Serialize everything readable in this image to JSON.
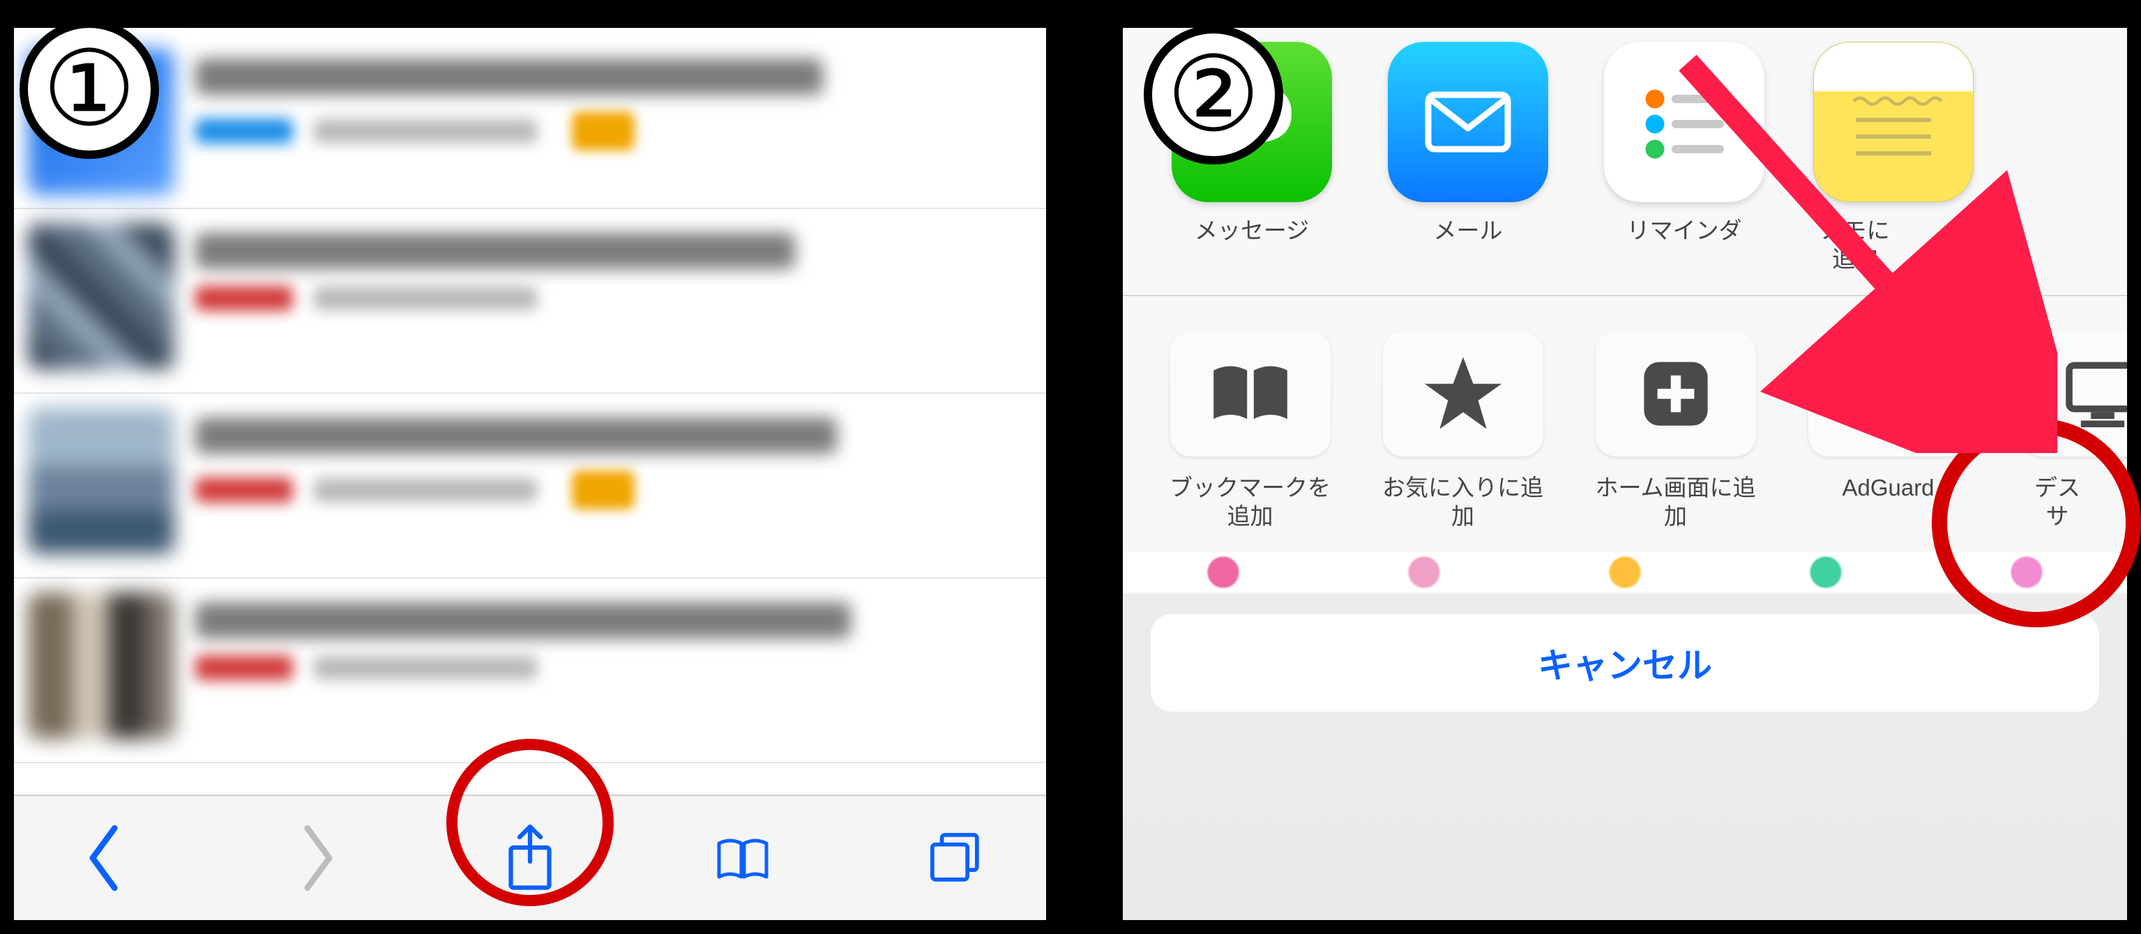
{
  "badges": {
    "one": "①",
    "two": "②"
  },
  "panel1": {
    "toolbar": {
      "back": "back-icon",
      "forward": "forward-icon",
      "share": "share-icon",
      "bookmarks": "bookmarks-icon",
      "tabs": "tabs-icon"
    }
  },
  "panel2": {
    "apps": [
      {
        "name": "messages",
        "label": "メッセージ"
      },
      {
        "name": "mail",
        "label": "メール"
      },
      {
        "name": "reminders",
        "label": "リマインダ"
      },
      {
        "name": "notes",
        "label": "メモに追加"
      }
    ],
    "actions": [
      {
        "name": "bookmark",
        "label": "ブックマークを追加"
      },
      {
        "name": "favorite",
        "label": "お気に入りに追加"
      },
      {
        "name": "homescreen",
        "label": "ホーム画面に追加"
      },
      {
        "name": "adguard",
        "label": "AdGuard"
      },
      {
        "name": "desktop",
        "label": "デス\nサ"
      }
    ],
    "cancel": "キャンセル"
  }
}
